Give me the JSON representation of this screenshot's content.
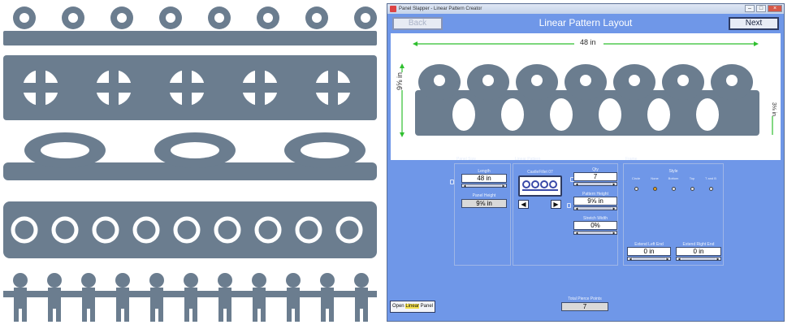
{
  "window": {
    "title": "Panel Slapper - Linear Pattern Creator"
  },
  "header": {
    "back_label": "Back",
    "next_label": "Next",
    "title": "Linear Pattern Layout"
  },
  "preview": {
    "length_label": "48 in",
    "height_label": "9⅝ in",
    "right_height_label": "3⅛ in"
  },
  "panel_size": {
    "title": "Panel Size",
    "length": {
      "label": "Length",
      "value": "48 in"
    },
    "panel_height": {
      "label": "Panel Height",
      "value": "9⅝ in"
    }
  },
  "linear_pattern": {
    "title": "Linear Pattern",
    "pattern_name": "CastleFillet 07",
    "qty": {
      "label": "Qty",
      "value": "7"
    },
    "pattern_height": {
      "label": "Pattern Height",
      "value": "9⅝ in"
    },
    "stretch_width": {
      "label": "Stretch Width",
      "value": "0%"
    }
  },
  "frame": {
    "title": "Frame",
    "style_label": "Style",
    "style_options": [
      "Circle",
      "None",
      "Bottom",
      "Top",
      "T and B"
    ],
    "selected_style": "None",
    "extend_left": {
      "label": "Extend Left End",
      "value": "0 in"
    },
    "extend_right": {
      "label": "Extend Right End",
      "value": "0 in"
    }
  },
  "footer": {
    "total_label": "Total Pierce Points",
    "total_value": "7",
    "open_btn": {
      "pre": "Open ",
      "highlight": "Linear",
      "post": " Panel"
    }
  },
  "colors": {
    "pattern": "#6b7d8f",
    "accent": "#6f97e8",
    "dimension": "#2fbf2f"
  }
}
